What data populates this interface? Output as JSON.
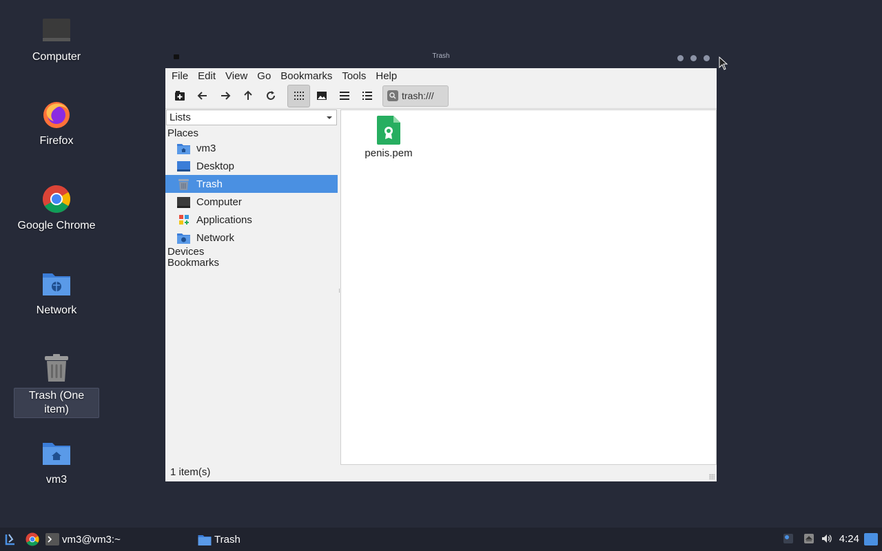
{
  "desktop": {
    "icons": [
      {
        "label": "Computer"
      },
      {
        "label": "Firefox"
      },
      {
        "label": "Google Chrome"
      },
      {
        "label": "Network"
      },
      {
        "label": "Trash (One item)"
      },
      {
        "label": "vm3"
      }
    ]
  },
  "window": {
    "title": "Trash",
    "menu": [
      "File",
      "Edit",
      "View",
      "Go",
      "Bookmarks",
      "Tools",
      "Help"
    ],
    "location": "trash:///",
    "sidebar": {
      "select_value": "Lists",
      "places_heading": "Places",
      "places": [
        {
          "label": "vm3",
          "icon": "home-folder-icon"
        },
        {
          "label": "Desktop",
          "icon": "desktop-icon"
        },
        {
          "label": "Trash",
          "icon": "trash-icon",
          "selected": true
        },
        {
          "label": "Computer",
          "icon": "computer-icon"
        },
        {
          "label": "Applications",
          "icon": "applications-icon"
        },
        {
          "label": "Network",
          "icon": "network-folder-icon"
        }
      ],
      "devices_heading": "Devices",
      "bookmarks_heading": "Bookmarks"
    },
    "files": [
      {
        "name": "penis.pem",
        "icon": "certificate-file-icon"
      }
    ],
    "status": "1 item(s)"
  },
  "taskbar": {
    "terminal_label": "vm3@vm3:~",
    "task_trash_label": "Trash",
    "clock": "4:24"
  },
  "colors": {
    "desktop_bg": "#262a38",
    "selection": "#4a90e2",
    "taskbar_bg": "#20232e"
  }
}
